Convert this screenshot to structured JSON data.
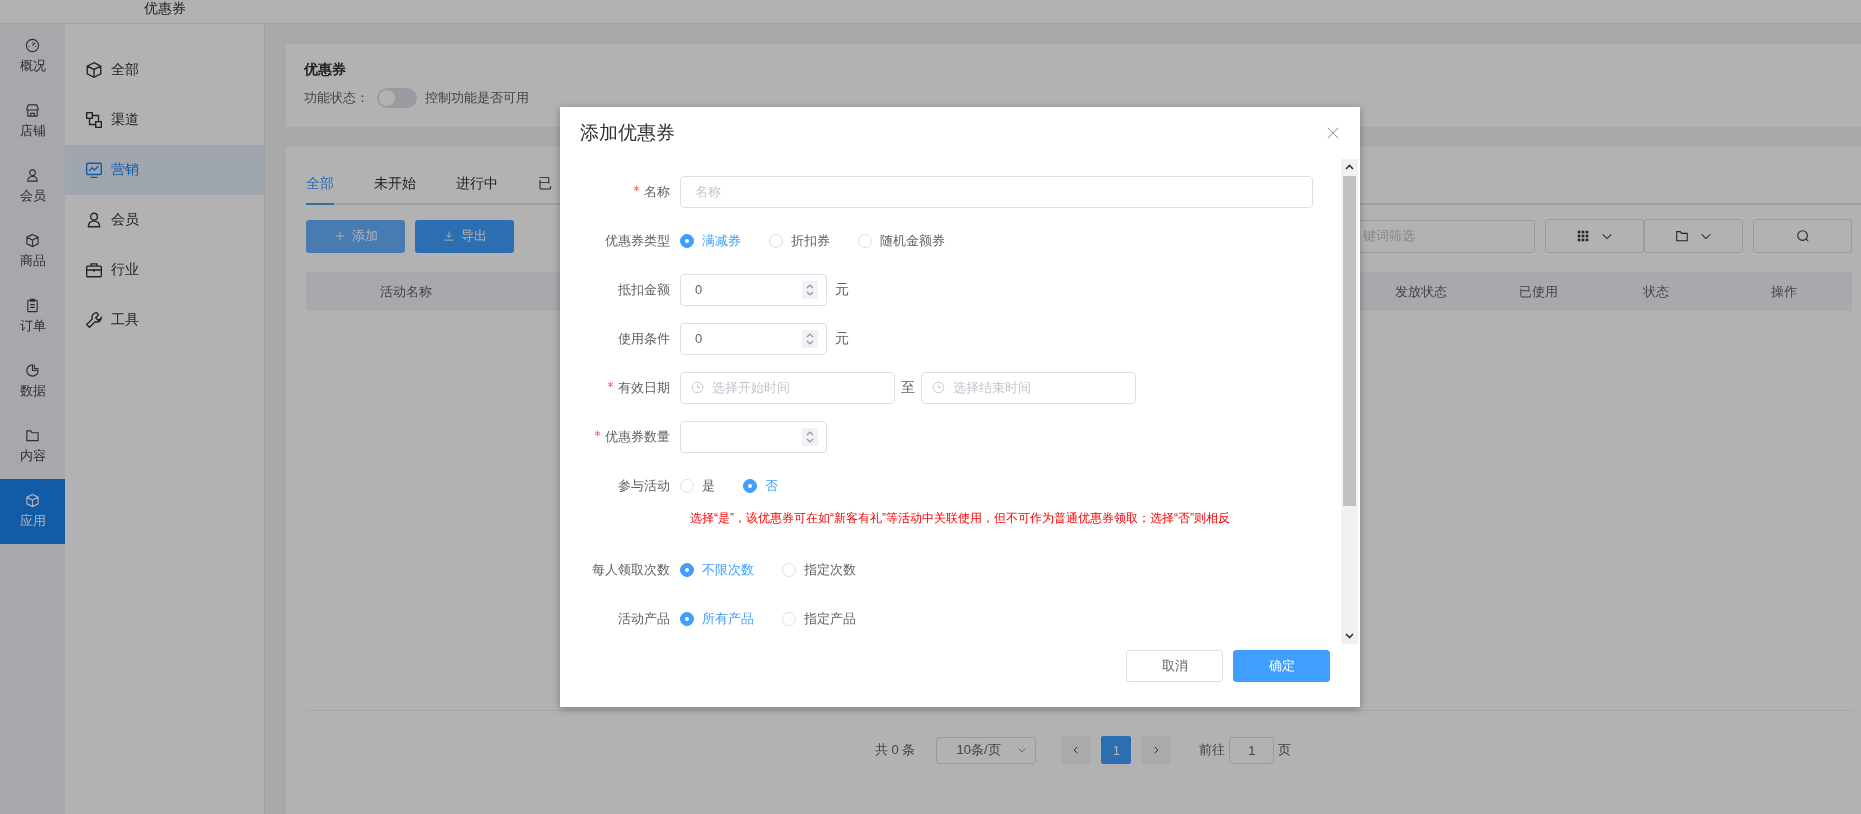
{
  "header": {
    "subtitle": "优惠券"
  },
  "rail": [
    {
      "label": "概况",
      "selected": false
    },
    {
      "label": "店铺",
      "selected": false
    },
    {
      "label": "会员",
      "selected": false
    },
    {
      "label": "商品",
      "selected": false
    },
    {
      "label": "订单",
      "selected": false
    },
    {
      "label": "数据",
      "selected": false
    },
    {
      "label": "内容",
      "selected": false
    },
    {
      "label": "应用",
      "selected": true
    }
  ],
  "sidebar": {
    "items": [
      {
        "label": "全部",
        "selected": false
      },
      {
        "label": "渠道",
        "selected": false
      },
      {
        "label": "营销",
        "selected": true
      },
      {
        "label": "会员",
        "selected": false
      },
      {
        "label": "行业",
        "selected": false
      },
      {
        "label": "工具",
        "selected": false
      }
    ]
  },
  "feature_card": {
    "title": "优惠券",
    "status_label": "功能状态：",
    "switch_on": false,
    "hint": "控制功能是否可用"
  },
  "tabs": [
    {
      "label": "全部",
      "selected": true
    },
    {
      "label": "未开始",
      "selected": false
    },
    {
      "label": "进行中",
      "selected": false
    },
    {
      "label": "已",
      "selected": false
    }
  ],
  "toolbar": {
    "buttons": [
      {
        "label": "添加",
        "kind": "add"
      },
      {
        "label": "导出",
        "kind": "export"
      }
    ],
    "search_placeholder": "键词筛选"
  },
  "table": {
    "columns": [
      "活动名称",
      "发放状态",
      "已使用",
      "状态",
      "操作"
    ]
  },
  "pagination": {
    "total": "共 0 条",
    "page_size": "10条/页",
    "pages": [
      {
        "label": "1",
        "selected": true
      }
    ],
    "goto_label": "前往",
    "goto_value": "1",
    "goto_suffix": "页"
  },
  "dialog": {
    "title": "添加优惠券",
    "fields": [
      {
        "kind": "text",
        "label": "名称",
        "required": true,
        "placeholder": "名称"
      },
      {
        "kind": "radio",
        "label": "优惠券类型",
        "required": false,
        "options": [
          {
            "label": "满减券",
            "selected": true
          },
          {
            "label": "折扣券",
            "selected": false
          },
          {
            "label": "随机金额券",
            "selected": false
          }
        ]
      },
      {
        "kind": "number",
        "label": "抵扣金额",
        "required": false,
        "value": "0",
        "unit": "元"
      },
      {
        "kind": "number",
        "label": "使用条件",
        "required": false,
        "value": "0",
        "unit": "元"
      },
      {
        "kind": "daterange",
        "label": "有效日期",
        "required": true,
        "start_placeholder": "选择开始时间",
        "separator": "至",
        "end_placeholder": "选择结束时间"
      },
      {
        "kind": "number",
        "label": "优惠券数量",
        "required": true
      },
      {
        "kind": "radio",
        "label": "参与活动",
        "required": false,
        "options": [
          {
            "label": "是",
            "selected": false
          },
          {
            "label": "否",
            "selected": true
          }
        ]
      },
      {
        "kind": "note",
        "text": "选择“是”，该优惠券可在如“新客有礼”等活动中关联使用，但不可作为普通优惠券领取；选择“否”则相反"
      },
      {
        "kind": "radio",
        "label": "每人领取次数",
        "required": false,
        "options": [
          {
            "label": "不限次数",
            "selected": true
          },
          {
            "label": "指定次数",
            "selected": false
          }
        ]
      },
      {
        "kind": "radio",
        "label": "活动产品",
        "required": false,
        "options": [
          {
            "label": "所有产品",
            "selected": true
          },
          {
            "label": "指定产品",
            "selected": false
          }
        ]
      }
    ],
    "buttons": [
      {
        "label": "取消",
        "kind": "default"
      },
      {
        "label": "确定",
        "kind": "primary"
      }
    ]
  }
}
